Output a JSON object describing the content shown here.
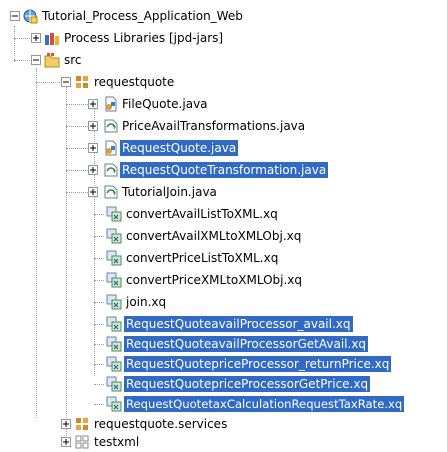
{
  "tree": {
    "project": "Tutorial_Process_Application_Web",
    "process_libraries": "Process Libraries [jpd-jars]",
    "src": "src",
    "package": "requestquote",
    "files": [
      "FileQuote.java",
      "PriceAvailTransformations.java",
      "RequestQuote.java",
      "RequestQuoteTransformation.java",
      "TutorialJoin.java",
      "convertAvailListToXML.xq",
      "convertAvailXMLtoXMLObj.xq",
      "convertPriceListToXML.xq",
      "convertPriceXMLtoXMLObj.xq",
      "join.xq",
      "RequestQuoteavailProcessor_avail.xq",
      "RequestQuoteavailProcessorGetAvail.xq",
      "RequestQuotepriceProcessor_returnPrice.xq",
      "RequestQuotepriceProcessorGetPrice.xq",
      "RequestQuotetaxCalculationRequestTaxRate.xq"
    ],
    "package_services": "requestquote.services",
    "testxml": "testxml"
  },
  "colors": {
    "selection": "#316ac5",
    "selection_text": "#ffffff"
  },
  "icons": {
    "project": "web-project-icon",
    "library": "library-icon",
    "folder": "source-folder-icon",
    "package": "package-icon",
    "java_process": "jpd-process-icon",
    "java_transform": "transformation-icon",
    "xquery": "xquery-icon"
  }
}
